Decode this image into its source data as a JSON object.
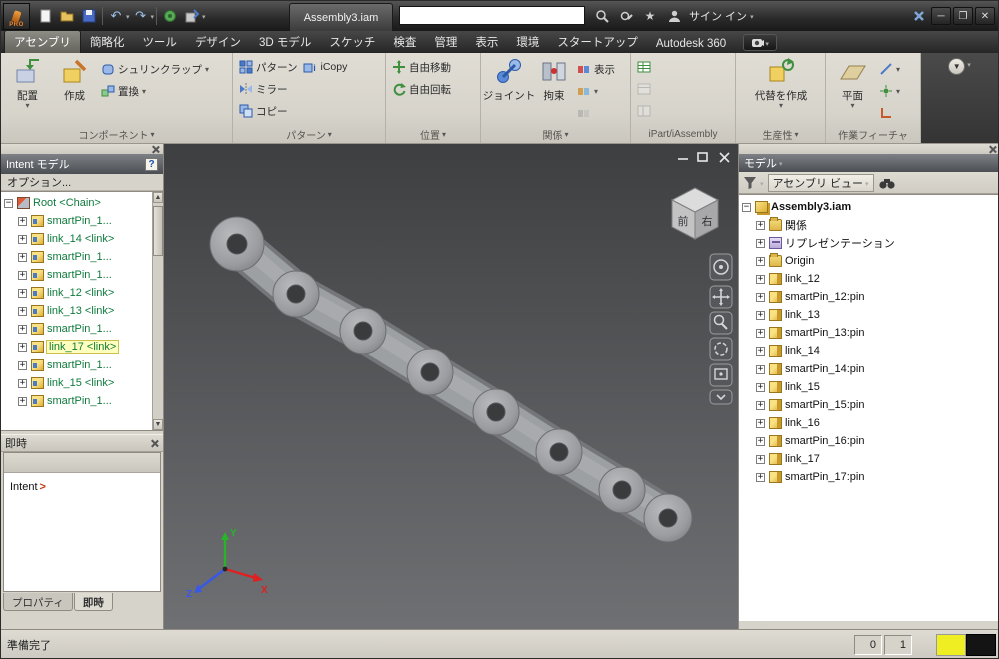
{
  "titlebar": {
    "badge": "PRO",
    "doc_tab": "Assembly3.iam",
    "signin_label": "サイン イン",
    "search_value": ""
  },
  "tabs": {
    "items": [
      "アセンブリ",
      "簡略化",
      "ツール",
      "デザイン",
      "3D モデル",
      "スケッチ",
      "検査",
      "管理",
      "表示",
      "環境",
      "スタートアップ",
      "Autodesk 360"
    ],
    "active": "アセンブリ"
  },
  "ribbon": {
    "component": {
      "label": "コンポーネント",
      "place": "配置",
      "create": "作成",
      "shrinkwrap": "シュリンクラップ",
      "replace": "置換"
    },
    "pattern": {
      "label": "パターン",
      "pattern": "パターン",
      "icopy": "iCopy",
      "mirror": "ミラー",
      "copy": "コピー"
    },
    "position": {
      "label": "位置",
      "free_move": "自由移動",
      "free_rotate": "自由回転"
    },
    "relationships": {
      "label": "関係",
      "joint": "ジョイント",
      "constrain": "拘束",
      "show": "表示"
    },
    "ipart": {
      "label": "iPart/iAssembly"
    },
    "productivity": {
      "label": "生産性",
      "substitute": "代替を作成"
    },
    "work_features": {
      "label": "作業フィーチャ",
      "plane": "平面"
    }
  },
  "intent_panel": {
    "title": "Intent モデル",
    "options": "オプション...",
    "tree": [
      {
        "label": "Root <Chain>",
        "type": "root",
        "expanded": true
      },
      {
        "label": "smartPin_1...",
        "type": "pin"
      },
      {
        "label": "link_14 <link>",
        "type": "link"
      },
      {
        "label": "smartPin_1...",
        "type": "pin"
      },
      {
        "label": "smartPin_1...",
        "type": "pin"
      },
      {
        "label": "link_12 <link>",
        "type": "link"
      },
      {
        "label": "link_13 <link>",
        "type": "link"
      },
      {
        "label": "smartPin_1...",
        "type": "pin"
      },
      {
        "label": "link_17 <link>",
        "type": "link",
        "selected": true
      },
      {
        "label": "smartPin_1...",
        "type": "pin"
      },
      {
        "label": "link_15 <link>",
        "type": "link"
      },
      {
        "label": "smartPin_1...",
        "type": "pin"
      }
    ]
  },
  "immediate_panel": {
    "title": "即時",
    "content": "Intent",
    "tabs": [
      "プロパティ",
      "即時"
    ],
    "active_tab": "即時"
  },
  "browser": {
    "title": "モデル",
    "view_selector": "アセンブリ ビュー",
    "tree": [
      {
        "label": "Assembly3.iam",
        "type": "assembly",
        "expanded": true
      },
      {
        "label": "関係",
        "type": "folder"
      },
      {
        "label": "リプレゼンテーション",
        "type": "rep"
      },
      {
        "label": "Origin",
        "type": "folder"
      },
      {
        "label": "link_12",
        "type": "part"
      },
      {
        "label": "smartPin_12:pin",
        "type": "part"
      },
      {
        "label": "link_13",
        "type": "part"
      },
      {
        "label": "smartPin_13:pin",
        "type": "part"
      },
      {
        "label": "link_14",
        "type": "part"
      },
      {
        "label": "smartPin_14:pin",
        "type": "part"
      },
      {
        "label": "link_15",
        "type": "part"
      },
      {
        "label": "smartPin_15:pin",
        "type": "part"
      },
      {
        "label": "link_16",
        "type": "part"
      },
      {
        "label": "smartPin_16:pin",
        "type": "part"
      },
      {
        "label": "link_17",
        "type": "part"
      },
      {
        "label": "smartPin_17:pin",
        "type": "part"
      }
    ]
  },
  "viewport": {
    "viewcube": {
      "front_face": "前",
      "right_face": "右"
    },
    "triad": {
      "x": "X",
      "y": "Y",
      "z": "Z"
    }
  },
  "statusbar": {
    "message": "準備完了",
    "counter1": "0",
    "counter2": "1"
  }
}
